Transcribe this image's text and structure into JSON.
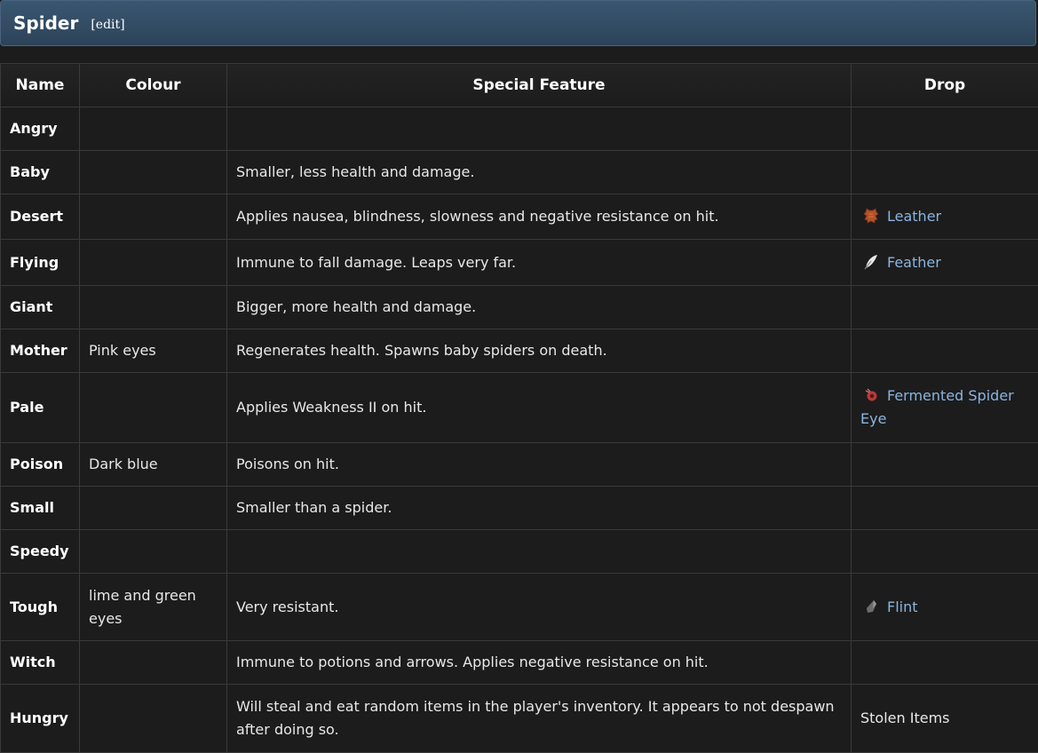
{
  "section": {
    "title": "Spider",
    "edit_label": "[edit]"
  },
  "table": {
    "headers": [
      "Name",
      "Colour",
      "Special Feature",
      "Drop"
    ],
    "rows": [
      {
        "name": "Angry",
        "colour": "",
        "feature": "",
        "drop": "",
        "drop_icon": ""
      },
      {
        "name": "Baby",
        "colour": "",
        "feature": "Smaller, less health and damage.",
        "drop": "",
        "drop_icon": ""
      },
      {
        "name": "Desert",
        "colour": "",
        "feature": "Applies nausea, blindness, slowness and negative resistance on hit.",
        "drop": "Leather",
        "drop_icon": "leather-icon"
      },
      {
        "name": "Flying",
        "colour": "",
        "feature": "Immune to fall damage. Leaps very far.",
        "drop": "Feather",
        "drop_icon": "feather-icon"
      },
      {
        "name": "Giant",
        "colour": "",
        "feature": "Bigger, more health and damage.",
        "drop": "",
        "drop_icon": ""
      },
      {
        "name": "Mother",
        "colour": "Pink eyes",
        "feature": "Regenerates health. Spawns baby spiders on death.",
        "drop": "",
        "drop_icon": ""
      },
      {
        "name": "Pale",
        "colour": "",
        "feature": "Applies Weakness II on hit.",
        "drop": "Fermented Spider Eye",
        "drop_icon": "fermented-spider-eye-icon"
      },
      {
        "name": "Poison",
        "colour": "Dark blue",
        "feature": "Poisons on hit.",
        "drop": "",
        "drop_icon": ""
      },
      {
        "name": "Small",
        "colour": "",
        "feature": "Smaller than a spider.",
        "drop": "",
        "drop_icon": ""
      },
      {
        "name": "Speedy",
        "colour": "",
        "feature": "",
        "drop": "",
        "drop_icon": ""
      },
      {
        "name": "Tough",
        "colour": "lime and green eyes",
        "feature": "Very resistant.",
        "drop": "Flint",
        "drop_icon": "flint-icon"
      },
      {
        "name": "Witch",
        "colour": "",
        "feature": "Immune to potions and arrows. Applies negative resistance on hit.",
        "drop": "",
        "drop_icon": ""
      },
      {
        "name": "Hungry",
        "colour": "",
        "feature": "Will steal and eat random items in the player's inventory. It appears to not despawn after doing so.",
        "drop": "Stolen Items",
        "drop_icon": "",
        "drop_plain": true
      }
    ]
  },
  "colors": {
    "header_bg": "#2c4459",
    "link": "#8ab4e0",
    "background": "#1c1c1c"
  }
}
